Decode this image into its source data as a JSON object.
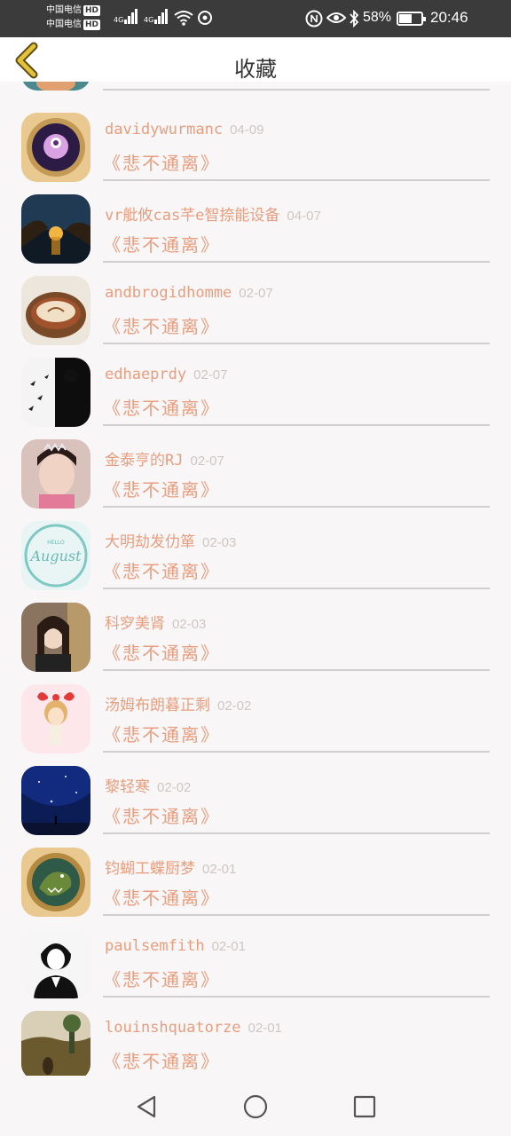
{
  "status_bar": {
    "carrier1": "中国电信",
    "carrier2": "中国电信",
    "hd": "HD",
    "net1": "4G",
    "net2": "4G",
    "battery_text": "58%",
    "battery_level": 0.58,
    "time": "20:46"
  },
  "header": {
    "title": "收藏"
  },
  "items": [
    {
      "name": "davidywurmanc",
      "date": "04-09",
      "poem": "《悲不通离》"
    },
    {
      "name": "vr舭攸cas芊e智捺能设备",
      "date": "04-07",
      "poem": "《悲不通离》"
    },
    {
      "name": "andbrogidhomme",
      "date": "02-07",
      "poem": "《悲不通离》"
    },
    {
      "name": "edhaeprdy",
      "date": "02-07",
      "poem": "《悲不通离》"
    },
    {
      "name": "金泰亨的RJ",
      "date": "02-07",
      "poem": "《悲不通离》"
    },
    {
      "name": "大明劫发仂箪",
      "date": "02-03",
      "poem": "《悲不通离》"
    },
    {
      "name": "科穸美肾",
      "date": "02-03",
      "poem": "《悲不通离》"
    },
    {
      "name": "汤姆布朗暮正剩",
      "date": "02-02",
      "poem": "《悲不通离》"
    },
    {
      "name": "黎轻寒",
      "date": "02-02",
      "poem": "《悲不通离》"
    },
    {
      "name": "钧蝴工蝶厨梦",
      "date": "02-01",
      "poem": "《悲不通离》"
    },
    {
      "name": "paulsemfith",
      "date": "02-01",
      "poem": "《悲不通离》"
    },
    {
      "name": "louinshquatorze",
      "date": "02-01",
      "poem": "《悲不通离》"
    }
  ],
  "colors": {
    "accent": "#e79e7f",
    "date": "#cfc6c3",
    "back_arrow": "#d8b93c"
  },
  "icons": {
    "back": "chevron-left-icon",
    "nav_back": "triangle-back-icon",
    "nav_home": "circle-home-icon",
    "nav_recents": "square-recents-icon"
  }
}
